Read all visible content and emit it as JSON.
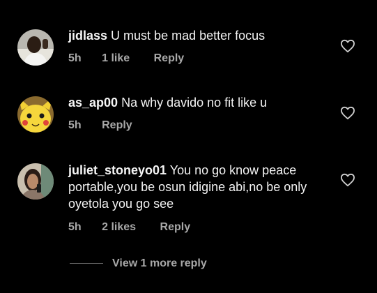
{
  "comments": [
    {
      "username": "jidlass",
      "text": "U must be mad better focus",
      "time": "5h",
      "likes": "1 like",
      "reply_label": "Reply",
      "avatar": "profile-photo-person",
      "action_icon": "heart-outline-icon"
    },
    {
      "username": "as_ap00",
      "text": "Na why davido no fit like u",
      "time": "5h",
      "reply_label": "Reply",
      "avatar": "profile-photo-pikachu",
      "action_icon": "heart-outline-icon"
    },
    {
      "username": "juliet_stoneyo01",
      "text": "You no go know peace portable,you be osun idigine abi,no be only oyetola you go see",
      "time": "5h",
      "likes": "2 likes",
      "reply_label": "Reply",
      "avatar": "profile-photo-selfie",
      "action_icon": "heart-outline-icon"
    }
  ],
  "view_more_label": "View 1 more reply",
  "colors": {
    "background": "#000000",
    "primary_text": "#f5f5f5",
    "secondary_text": "#a8a8a8"
  }
}
